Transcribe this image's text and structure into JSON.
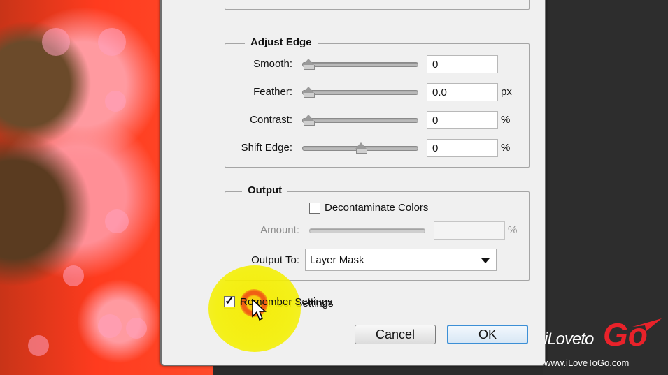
{
  "adjust_edge": {
    "title": "Adjust Edge",
    "smooth": {
      "label": "Smooth:",
      "value": "0",
      "unit": "",
      "level": 0
    },
    "feather": {
      "label": "Feather:",
      "value": "0.0",
      "unit": "px",
      "level": 0
    },
    "contrast": {
      "label": "Contrast:",
      "value": "0",
      "unit": "%",
      "level": 0
    },
    "shift_edge": {
      "label": "Shift Edge:",
      "value": "0",
      "unit": "%",
      "level": 0.5
    }
  },
  "output": {
    "title": "Output",
    "decontaminate_label": "Decontaminate Colors",
    "decontaminate_checked": false,
    "amount": {
      "label": "Amount:",
      "value": "",
      "unit": "%"
    },
    "output_to": {
      "label": "Output To:",
      "value": "Layer Mask"
    }
  },
  "remember_settings": {
    "label": "Remember Settings",
    "checked": true
  },
  "buttons": {
    "cancel": "Cancel",
    "ok": "OK"
  },
  "logo": {
    "prefix": "iLoveto",
    "brand": "Go",
    "url": "www.iLoveToGo.com"
  },
  "colors": {
    "accent": "#3c8fd6",
    "highlight": "#f5f000",
    "brand_red": "#e8222a"
  }
}
